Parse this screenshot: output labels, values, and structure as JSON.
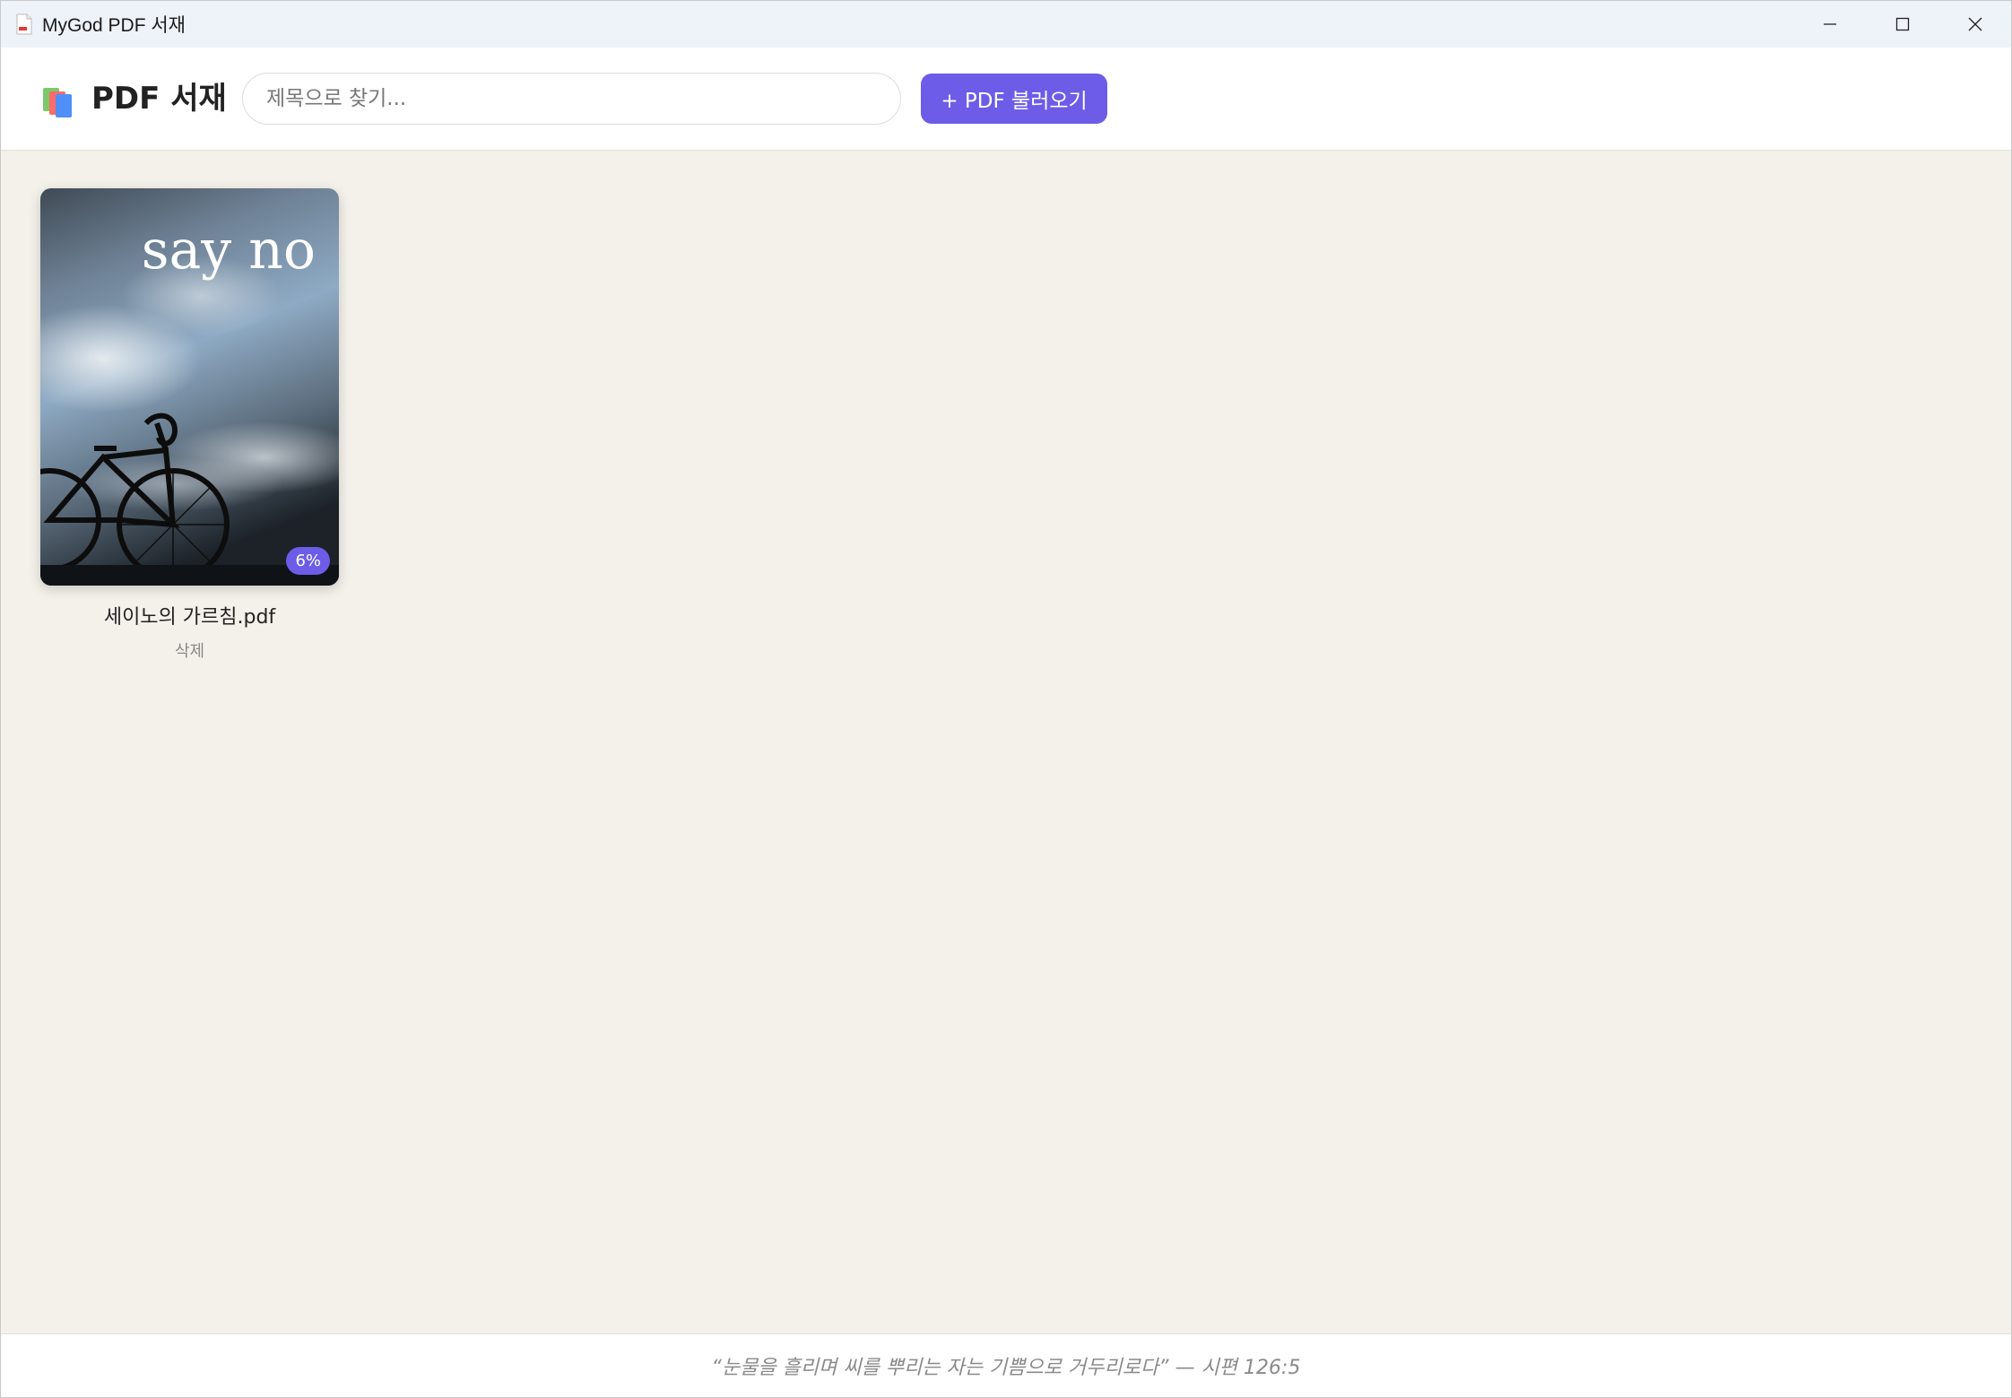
{
  "window": {
    "title": "MyGod PDF 서재",
    "icon": "pdf-file-icon",
    "controls": [
      "minimize-icon",
      "maximize-icon",
      "close-icon"
    ]
  },
  "header": {
    "logo_icon": "books-icon",
    "title": "PDF 서재",
    "search": {
      "placeholder": "제목으로 찾기...",
      "value": ""
    },
    "import_button": {
      "label": "+ PDF 불러오기"
    }
  },
  "books": [
    {
      "file_name": "세이노의 가르침.pdf",
      "cover_text": "say no",
      "progress_percent": 6,
      "progress_label": "6%",
      "delete_label": "삭제"
    }
  ],
  "footer": {
    "quote": "“눈물을 흘리며 씨를 뿌리는 자는 기쁨으로 거두리로다” — 시편 126:5"
  },
  "colors": {
    "accent": "#6c5ce7",
    "background": "#f4f1ea",
    "titlebar": "#eef2f9"
  }
}
